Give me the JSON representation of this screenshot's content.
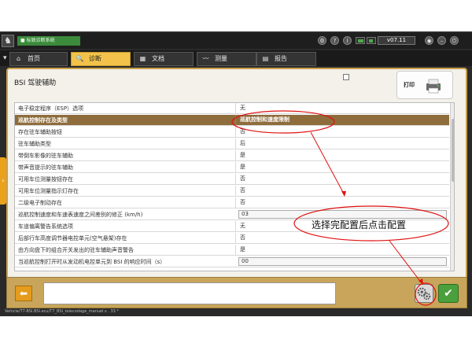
{
  "titlebar": {
    "app_title": "■ 标致诊断系统",
    "version": "v07.11"
  },
  "tabs": [
    {
      "label": "首页",
      "icon": "home-icon",
      "glyph": "⌂"
    },
    {
      "label": "诊断",
      "icon": "diagnosis-icon",
      "glyph": "🔍"
    },
    {
      "label": "文档",
      "icon": "document-icon",
      "glyph": "▦"
    },
    {
      "label": "测量",
      "icon": "measure-icon",
      "glyph": "〰"
    },
    {
      "label": "报告",
      "icon": "report-icon",
      "glyph": "▤"
    }
  ],
  "page": {
    "title": "BSI 驾驶辅助",
    "print_label": "打印"
  },
  "rows": [
    {
      "label": "电子稳定程序（ESP）选项",
      "value": "无"
    },
    {
      "label": "巡航控制存在及类型",
      "value": "巡航控制和速度限制"
    },
    {
      "label": "存在驻车辅助按钮",
      "value": "否"
    },
    {
      "label": "驻车辅助类型",
      "value": "后"
    },
    {
      "label": "带倒车影像的驻车辅助",
      "value": "是"
    },
    {
      "label": "带声音提示的驻车辅助",
      "value": "是"
    },
    {
      "label": "可用车位测量按钮存在",
      "value": "否"
    },
    {
      "label": "可用车位测量指示灯存在",
      "value": "否"
    },
    {
      "label": "二级电子制动存在",
      "value": "否"
    },
    {
      "label": "巡航控制速度和车速表速度之间差别的修正 (km/h)",
      "value": "03"
    },
    {
      "label": "车道偏离警告系统选项",
      "value": "无"
    },
    {
      "label": "后部行车高度调节器电控单元(空气悬架)存在",
      "value": "否"
    },
    {
      "label": "由方向盘下的组合开关发出的驻车辅助声音警告",
      "value": "是"
    },
    {
      "label": "当巡航控制打开时从发动机电控单元到 BSI 的响应时间（s）",
      "value": "00"
    }
  ],
  "statusbar": {
    "text": "Vehicle/T7-BSI.BSI.ecu/T7_BSI_telecodage_manuel.s . 33 *"
  },
  "annotation": {
    "text": "选择完配置后点击配置"
  },
  "colors": {
    "accent": "#f2c24a",
    "selected_row": "#8e6c3c",
    "annotation": "#e01010"
  }
}
